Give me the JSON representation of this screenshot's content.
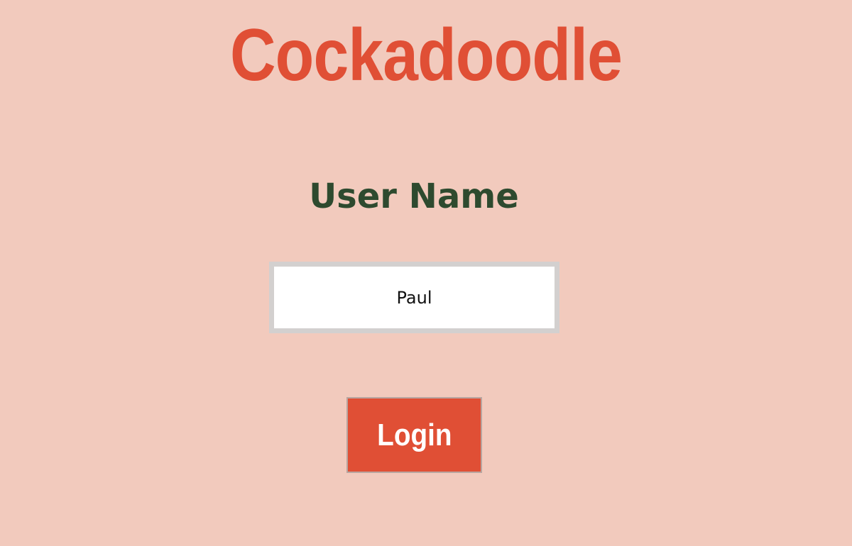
{
  "app": {
    "title": "Cockadoodle"
  },
  "login_form": {
    "username_label": "User Name",
    "username_value": "Paul",
    "login_button_label": "Login"
  },
  "colors": {
    "background": "#f2cabd",
    "accent": "#e04f35",
    "label_text": "#2e4a2f",
    "input_border": "#d3d0cf"
  }
}
